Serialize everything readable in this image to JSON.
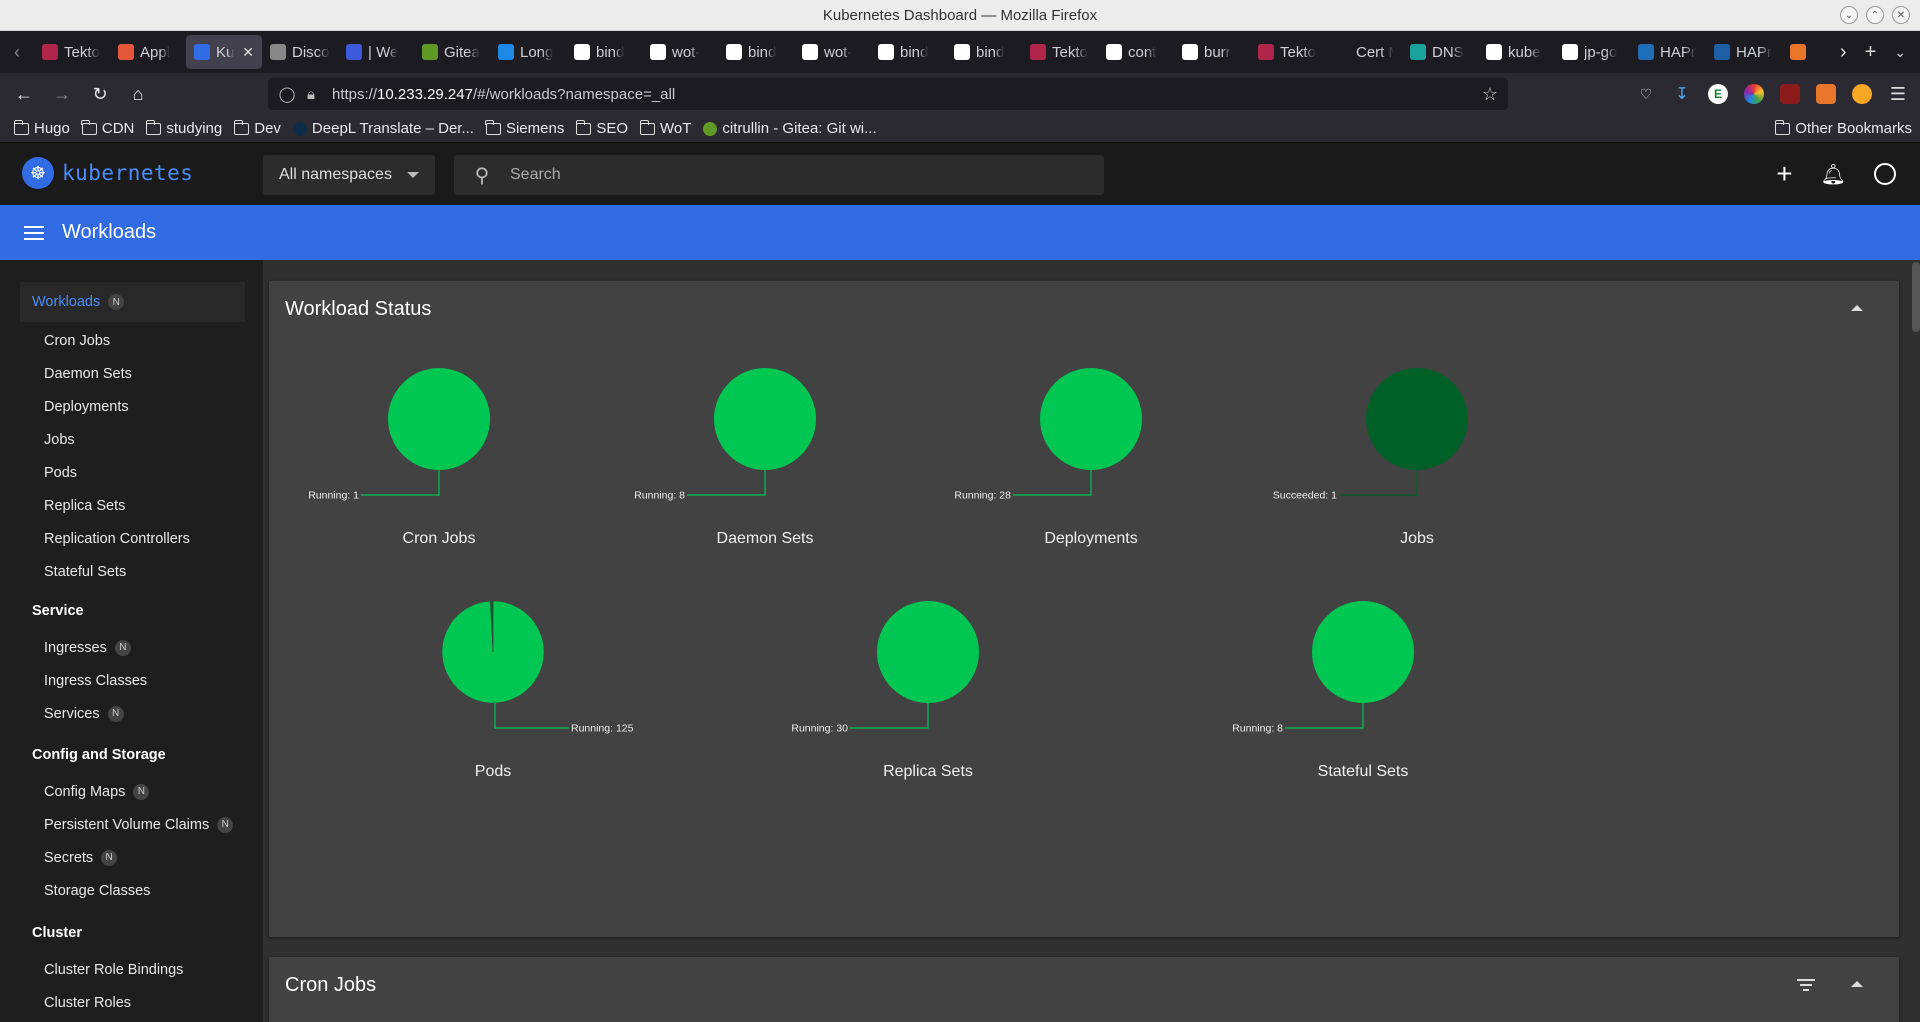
{
  "window": {
    "title": "Kubernetes Dashboard — Mozilla Firefox"
  },
  "tabs": [
    {
      "label": "Tekto",
      "color": "#b0264a"
    },
    {
      "label": "Appl",
      "color": "#e2573a"
    },
    {
      "label": "Ku",
      "color": "#326ce5",
      "active": true
    },
    {
      "label": "Disco",
      "color": "#888888"
    },
    {
      "label": "| We",
      "color": "#3b5bdb"
    },
    {
      "label": "Gitea",
      "color": "#609926"
    },
    {
      "label": "Long",
      "color": "#1e88e5"
    },
    {
      "label": "bind",
      "color": "#ffffff"
    },
    {
      "label": "wot-",
      "color": "#ffffff"
    },
    {
      "label": "bind",
      "color": "#ffffff"
    },
    {
      "label": "wot-",
      "color": "#ffffff"
    },
    {
      "label": "bind",
      "color": "#ffffff"
    },
    {
      "label": "bind",
      "color": "#ffffff"
    },
    {
      "label": "Tekto",
      "color": "#b0264a"
    },
    {
      "label": "cont",
      "color": "#ffffff"
    },
    {
      "label": "burr",
      "color": "#ffffff"
    },
    {
      "label": "Tekto",
      "color": "#b0264a"
    },
    {
      "label": "Cert Ma",
      "color": "#1c1b22"
    },
    {
      "label": "DNS",
      "color": "#1ba39c"
    },
    {
      "label": "kube",
      "color": "#ffffff"
    },
    {
      "label": "jp-go",
      "color": "#ffffff"
    },
    {
      "label": "HAPr",
      "color": "#1e6fb8"
    },
    {
      "label": "HAPr",
      "color": "#1e5fa8"
    },
    {
      "label": "",
      "color": "#e8762b"
    }
  ],
  "nav": {
    "url_prefix": "https://",
    "url_host": "10.233.29.247",
    "url_path": "/#/workloads?namespace=_all"
  },
  "bookmarks": [
    {
      "label": "Hugo",
      "type": "folder"
    },
    {
      "label": "CDN",
      "type": "folder"
    },
    {
      "label": "studying",
      "type": "folder"
    },
    {
      "label": "Dev",
      "type": "folder"
    },
    {
      "label": "DeepL Translate – Der...",
      "type": "link",
      "color": "#0f2b46"
    },
    {
      "label": "Siemens",
      "type": "folder"
    },
    {
      "label": "SEO",
      "type": "folder"
    },
    {
      "label": "WoT",
      "type": "folder"
    },
    {
      "label": "citrullin - Gitea: Git wi...",
      "type": "link",
      "color": "#609926"
    }
  ],
  "bookmarks_other": "Other Bookmarks",
  "app": {
    "logo_text": "kubernetes",
    "namespace": "All namespaces",
    "search_placeholder": "Search",
    "page_title": "Workloads"
  },
  "sidebar": {
    "workloads": {
      "label": "Workloads",
      "badge": "N"
    },
    "workload_items": [
      "Cron Jobs",
      "Daemon Sets",
      "Deployments",
      "Jobs",
      "Pods",
      "Replica Sets",
      "Replication Controllers",
      "Stateful Sets"
    ],
    "service": {
      "label": "Service"
    },
    "service_items": [
      {
        "label": "Ingresses",
        "badge": "N"
      },
      {
        "label": "Ingress Classes",
        "badge": ""
      },
      {
        "label": "Services",
        "badge": "N"
      }
    ],
    "config": {
      "label": "Config and Storage"
    },
    "config_items": [
      {
        "label": "Config Maps",
        "badge": "N"
      },
      {
        "label": "Persistent Volume Claims",
        "badge": "N"
      },
      {
        "label": "Secrets",
        "badge": "N"
      },
      {
        "label": "Storage Classes",
        "badge": ""
      }
    ],
    "cluster": {
      "label": "Cluster"
    },
    "cluster_items": [
      "Cluster Role Bindings",
      "Cluster Roles"
    ]
  },
  "workload_status": {
    "title": "Workload Status"
  },
  "cron_jobs_card": {
    "title": "Cron Jobs"
  },
  "chart_data": [
    {
      "type": "pie",
      "title": "Cron Jobs",
      "slices": [
        {
          "label": "Running: 1",
          "status": "Running",
          "value": 1,
          "color": "#00c752"
        }
      ]
    },
    {
      "type": "pie",
      "title": "Daemon Sets",
      "slices": [
        {
          "label": "Running: 8",
          "status": "Running",
          "value": 8,
          "color": "#00c752"
        }
      ]
    },
    {
      "type": "pie",
      "title": "Deployments",
      "slices": [
        {
          "label": "Running: 28",
          "status": "Running",
          "value": 28,
          "color": "#00c752"
        }
      ]
    },
    {
      "type": "pie",
      "title": "Jobs",
      "slices": [
        {
          "label": "Succeeded: 1",
          "status": "Succeeded",
          "value": 1,
          "color": "#006028"
        }
      ]
    },
    {
      "type": "pie",
      "title": "Pods",
      "slices": [
        {
          "label": "Running: 125",
          "status": "Running",
          "value": 125,
          "color": "#00c752"
        },
        {
          "label": "",
          "status": "Succeeded",
          "value": 1,
          "color": "#006028"
        }
      ]
    },
    {
      "type": "pie",
      "title": "Replica Sets",
      "slices": [
        {
          "label": "Running: 30",
          "status": "Running",
          "value": 30,
          "color": "#00c752"
        }
      ]
    },
    {
      "type": "pie",
      "title": "Stateful Sets",
      "slices": [
        {
          "label": "Running: 8",
          "status": "Running",
          "value": 8,
          "color": "#00c752"
        }
      ]
    }
  ]
}
